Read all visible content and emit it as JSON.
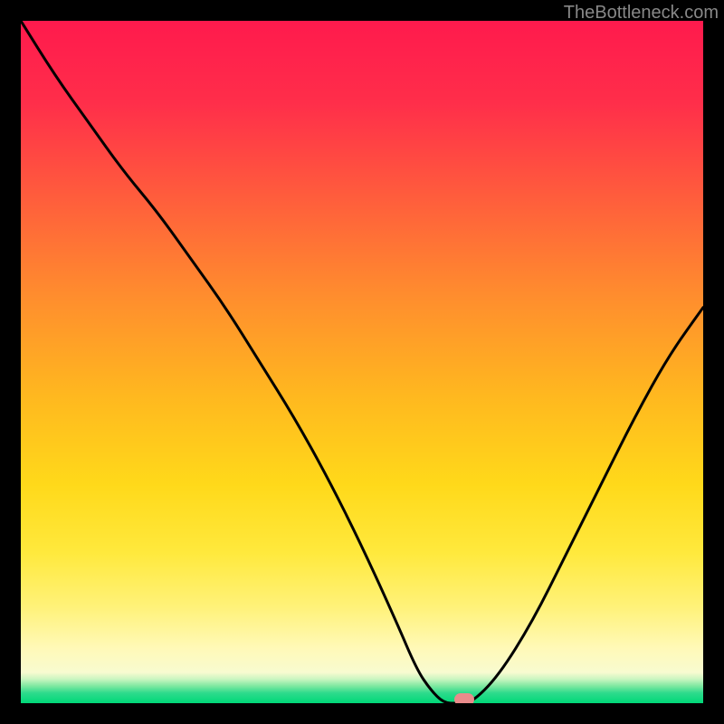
{
  "watermark": "TheBottleneck.com",
  "chart_data": {
    "type": "line",
    "title": "",
    "xlabel": "",
    "ylabel": "",
    "xlim": [
      0,
      100
    ],
    "ylim": [
      0,
      100
    ],
    "grid": false,
    "gradient_colors": {
      "top": "#ff1744",
      "upper_mid": "#ff5722",
      "mid": "#ffc107",
      "lower_mid": "#ffeb3b",
      "lower": "#fff59d",
      "bottom_band": "#00e676"
    },
    "series": [
      {
        "name": "bottleneck-curve",
        "x": [
          0,
          5,
          10,
          15,
          20,
          25,
          30,
          35,
          40,
          45,
          50,
          55,
          58,
          60,
          62,
          64,
          66,
          70,
          75,
          80,
          85,
          90,
          95,
          100
        ],
        "y": [
          100,
          92,
          85,
          78,
          72,
          65,
          58,
          50,
          42,
          33,
          23,
          12,
          5,
          2,
          0,
          0,
          0,
          4,
          12,
          22,
          32,
          42,
          51,
          58
        ]
      }
    ],
    "marker": {
      "x": 65,
      "y": 0,
      "color": "#e98b8b"
    }
  }
}
